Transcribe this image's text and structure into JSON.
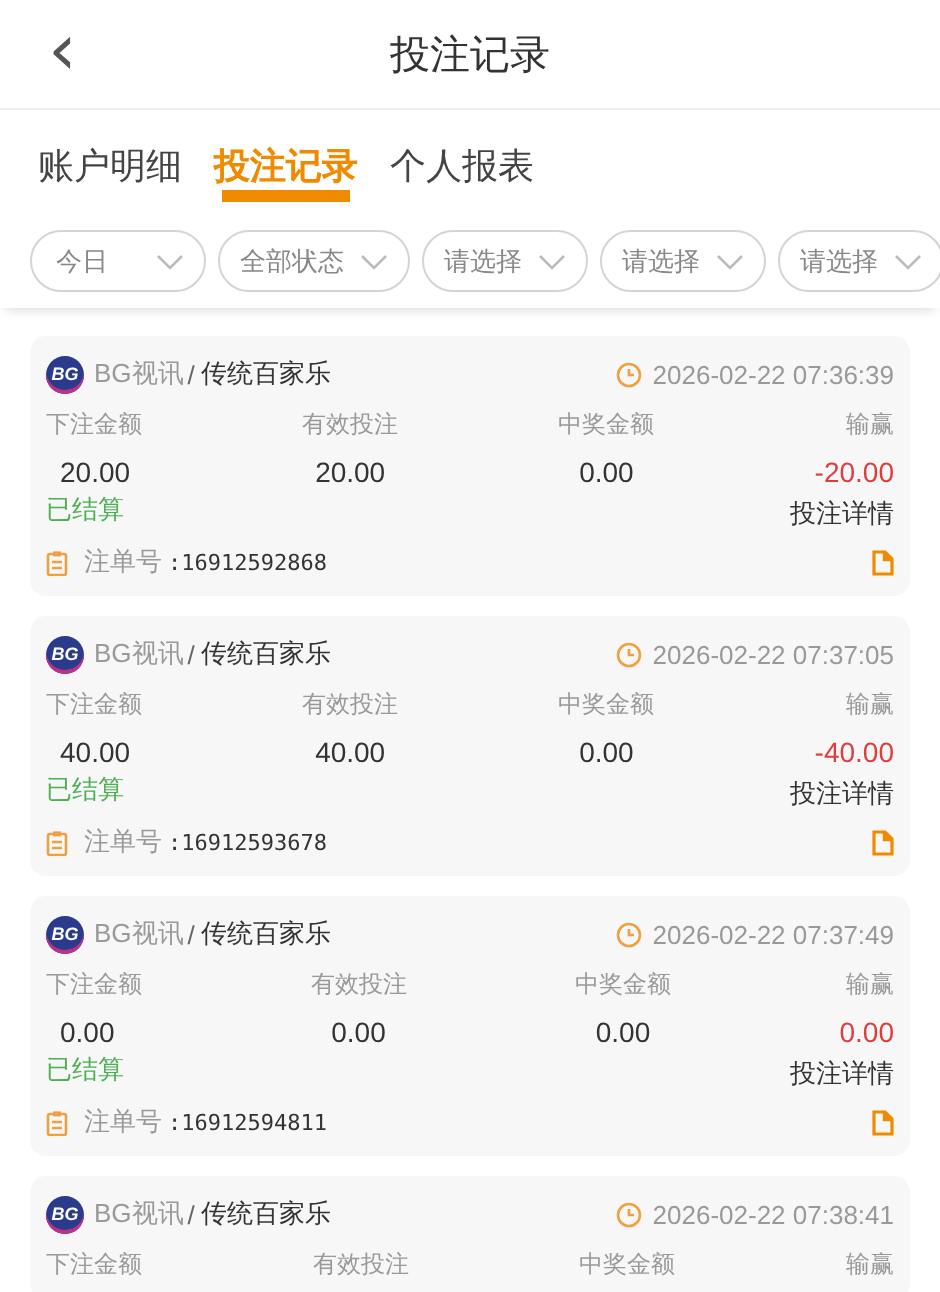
{
  "header": {
    "back_icon": "‹",
    "title": "投注记录"
  },
  "tabs": [
    {
      "label": "账户明细",
      "selected": false
    },
    {
      "label": "投注记录",
      "selected": true
    },
    {
      "label": "个人报表",
      "selected": false
    }
  ],
  "filters": [
    "今日",
    "全部状态",
    "请选择",
    "请选择",
    "请选择"
  ],
  "records": [
    {
      "logo_text": "BG",
      "provider": "BG视讯",
      "separator": "/",
      "game": "传统百家乐",
      "time": "2026-02-22 07:36:39",
      "columns": [
        {
          "label": "下注金额",
          "value": "20.00"
        },
        {
          "label": "有效投注",
          "value": "20.00"
        },
        {
          "label": "中奖金额",
          "value": "0.00"
        },
        {
          "label": "输赢",
          "value": "-20.00"
        }
      ],
      "status": "已结算",
      "detail": "投注详情",
      "order_label": "注单号",
      "order_no": ":16912592868"
    },
    {
      "logo_text": "BG",
      "provider": "BG视讯",
      "separator": "/",
      "game": "传统百家乐",
      "time": "2026-02-22 07:37:05",
      "columns": [
        {
          "label": "下注金额",
          "value": "40.00"
        },
        {
          "label": "有效投注",
          "value": "40.00"
        },
        {
          "label": "中奖金额",
          "value": "0.00"
        },
        {
          "label": "输赢",
          "value": "-40.00"
        }
      ],
      "status": "已结算",
      "detail": "投注详情",
      "order_label": "注单号",
      "order_no": ":16912593678"
    },
    {
      "logo_text": "BG",
      "provider": "BG视讯",
      "separator": "/",
      "game": "传统百家乐",
      "time": "2026-02-22 07:37:49",
      "columns": [
        {
          "label": "下注金额",
          "value": "0.00"
        },
        {
          "label": "有效投注",
          "value": "0.00"
        },
        {
          "label": "中奖金额",
          "value": "0.00"
        },
        {
          "label": "输赢",
          "value": "0.00"
        }
      ],
      "status": "已结算",
      "detail": "投注详情",
      "order_label": "注单号",
      "order_no": ":16912594811"
    },
    {
      "logo_text": "BG",
      "provider": "BG视讯",
      "separator": "/",
      "game": "传统百家乐",
      "time": "2026-02-22 07:38:41",
      "columns": [
        {
          "label": "下注金额"
        },
        {
          "label": "有效投注"
        },
        {
          "label": "中奖金额"
        },
        {
          "label": "输赢"
        }
      ]
    }
  ]
}
